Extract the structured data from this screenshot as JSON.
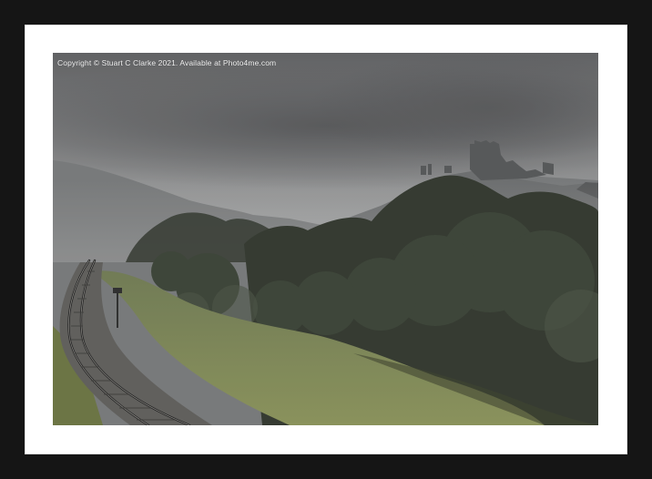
{
  "photo": {
    "copyright": "Copyright © Stuart C Clarke 2021. Available at Photo4me.com"
  },
  "frame": {
    "frame_color": "#151515",
    "mount_color": "#ffffff"
  }
}
